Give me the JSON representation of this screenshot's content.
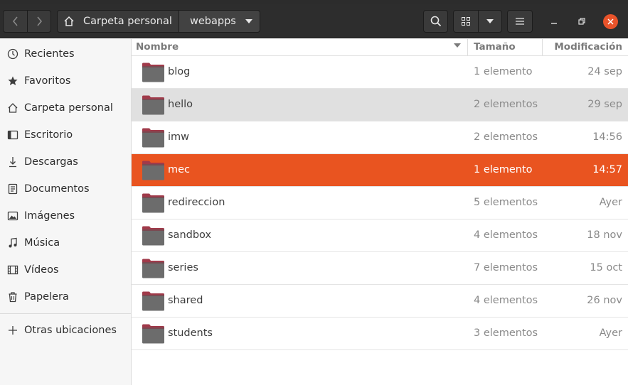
{
  "headerbar": {
    "path_home_label": "Carpeta personal",
    "path_current_label": "webapps"
  },
  "sidebar": {
    "items": [
      {
        "label": "Recientes",
        "icon": "clock-icon"
      },
      {
        "label": "Favoritos",
        "icon": "star-icon"
      },
      {
        "label": "Carpeta personal",
        "icon": "home-icon"
      },
      {
        "label": "Escritorio",
        "icon": "desktop-icon"
      },
      {
        "label": "Descargas",
        "icon": "download-icon"
      },
      {
        "label": "Documentos",
        "icon": "document-icon"
      },
      {
        "label": "Imágenes",
        "icon": "image-icon"
      },
      {
        "label": "Música",
        "icon": "music-icon"
      },
      {
        "label": "Vídeos",
        "icon": "video-icon"
      },
      {
        "label": "Papelera",
        "icon": "trash-icon"
      }
    ],
    "other_locations": "Otras ubicaciones"
  },
  "columns": {
    "name": "Nombre",
    "size": "Tamaño",
    "modified": "Modificación"
  },
  "files": [
    {
      "name": "blog",
      "size": "1 elemento",
      "modified": "24 sep"
    },
    {
      "name": "hello",
      "size": "2 elementos",
      "modified": "29 sep"
    },
    {
      "name": "imw",
      "size": "2 elementos",
      "modified": "14:56"
    },
    {
      "name": "mec",
      "size": "1 elemento",
      "modified": "14:57"
    },
    {
      "name": "redireccion",
      "size": "5 elementos",
      "modified": "Ayer"
    },
    {
      "name": "sandbox",
      "size": "4 elementos",
      "modified": "18 nov"
    },
    {
      "name": "series",
      "size": "7 elementos",
      "modified": "15 oct"
    },
    {
      "name": "shared",
      "size": "4 elementos",
      "modified": "26 nov"
    },
    {
      "name": "students",
      "size": "3 elementos",
      "modified": "Ayer"
    }
  ],
  "colors": {
    "accent": "#e95420",
    "close_button": "#e9532a",
    "headerbar": "#2d2d2d"
  }
}
